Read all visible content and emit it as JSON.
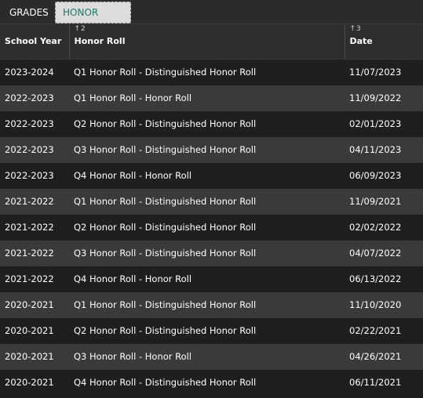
{
  "tabs": {
    "grades": "GRADES",
    "honor_roll": "HONOR ROLL"
  },
  "table": {
    "headers": [
      {
        "label": "School Year",
        "sort": ""
      },
      {
        "label": "Honor Roll",
        "sort": "2"
      },
      {
        "label": "Date",
        "sort": "3"
      }
    ],
    "rows": [
      [
        "2023-2024",
        "Q1 Honor Roll - Distinguished Honor Roll",
        "11/07/2023"
      ],
      [
        "2022-2023",
        "Q1 Honor Roll - Honor Roll",
        "11/09/2022"
      ],
      [
        "2022-2023",
        "Q2 Honor Roll - Distinguished Honor Roll",
        "02/01/2023"
      ],
      [
        "2022-2023",
        "Q3 Honor Roll - Distinguished Honor Roll",
        "04/11/2023"
      ],
      [
        "2022-2023",
        "Q4 Honor Roll - Honor Roll",
        "06/09/2023"
      ],
      [
        "2021-2022",
        "Q1 Honor Roll - Distinguished Honor Roll",
        "11/09/2021"
      ],
      [
        "2021-2022",
        "Q2 Honor Roll - Distinguished Honor Roll",
        "02/02/2022"
      ],
      [
        "2021-2022",
        "Q3 Honor Roll - Distinguished Honor Roll",
        "04/07/2022"
      ],
      [
        "2021-2022",
        "Q4 Honor Roll - Honor Roll",
        "06/13/2022"
      ],
      [
        "2020-2021",
        "Q1 Honor Roll - Distinguished Honor Roll",
        "11/10/2020"
      ],
      [
        "2020-2021",
        "Q2 Honor Roll - Distinguished Honor Roll",
        "02/22/2021"
      ],
      [
        "2020-2021",
        "Q3 Honor Roll - Honor Roll",
        "04/26/2021"
      ],
      [
        "2020-2021",
        "Q4 Honor Roll - Distinguished Honor Roll",
        "06/11/2021"
      ]
    ]
  },
  "colors": {
    "active_tab_text": "#1e7a67",
    "active_tab_bg": "#dcdcdc",
    "row_odd": "#1f1f1f",
    "row_even": "#3a3a3a"
  },
  "icons": {
    "sort": "sort-ascending-icon"
  }
}
